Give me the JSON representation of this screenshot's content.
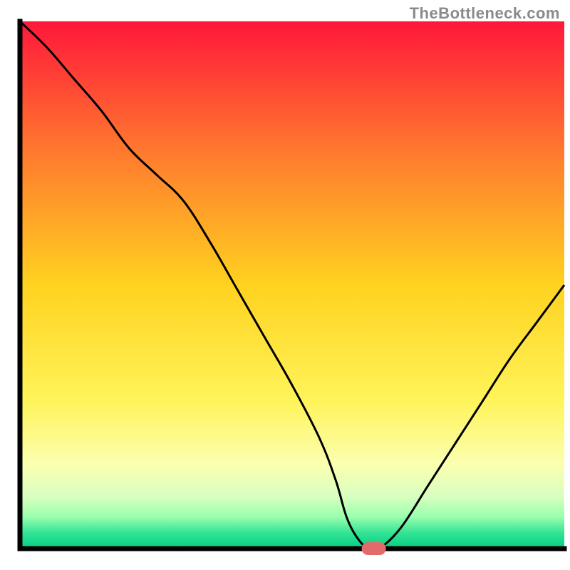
{
  "attribution": "TheBottleneck.com",
  "chart_data": {
    "type": "line",
    "title": "",
    "xlabel": "",
    "ylabel": "",
    "xlim": [
      0,
      100
    ],
    "ylim": [
      0,
      100
    ],
    "x": [
      0,
      5,
      10,
      15,
      20,
      25,
      30,
      35,
      40,
      45,
      50,
      55,
      58,
      60,
      62,
      64,
      66,
      70,
      75,
      80,
      85,
      90,
      95,
      100
    ],
    "values": [
      100,
      95,
      89,
      83,
      76,
      71,
      66,
      58,
      49,
      40,
      31,
      21,
      13,
      6,
      2,
      0,
      0,
      4,
      12,
      20,
      28,
      36,
      43,
      50
    ],
    "marker": {
      "x": 65,
      "y": 0
    },
    "background_gradient": {
      "stops": [
        {
          "offset": 0.0,
          "color": "#ff173a"
        },
        {
          "offset": 0.25,
          "color": "#ff7a2e"
        },
        {
          "offset": 0.5,
          "color": "#ffd21f"
        },
        {
          "offset": 0.72,
          "color": "#fff45a"
        },
        {
          "offset": 0.84,
          "color": "#fbffb0"
        },
        {
          "offset": 0.9,
          "color": "#d9ffc0"
        },
        {
          "offset": 0.94,
          "color": "#9affad"
        },
        {
          "offset": 0.97,
          "color": "#34e396"
        },
        {
          "offset": 1.0,
          "color": "#00d081"
        }
      ]
    },
    "axis_color": "#000000",
    "marker_color": "#e26a6a"
  }
}
